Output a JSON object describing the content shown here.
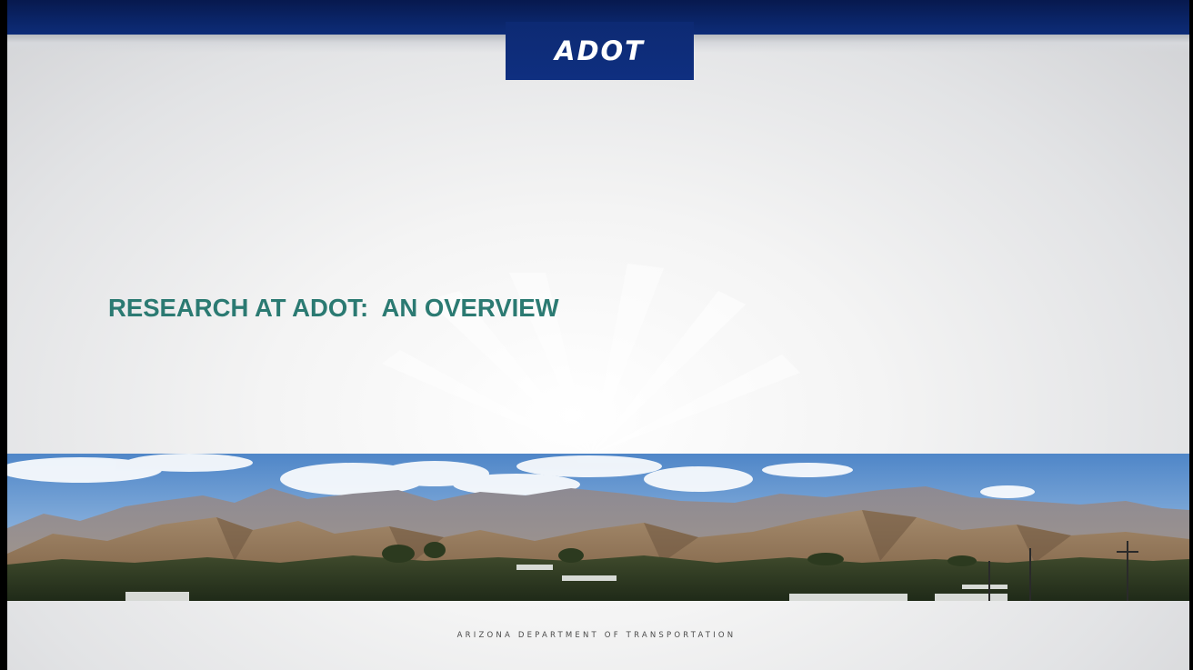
{
  "slide": {
    "logo_text": "ADOT",
    "title": "RESEARCH AT ADOT:  AN OVERVIEW",
    "footer": "ARIZONA DEPARTMENT OF TRANSPORTATION",
    "photo_alt": "panorama of desert mountains under a cloudy sky",
    "colors": {
      "brand_navy": "#0d2c78",
      "title_teal": "#2b7a72",
      "background": "#e6e7e9"
    }
  }
}
